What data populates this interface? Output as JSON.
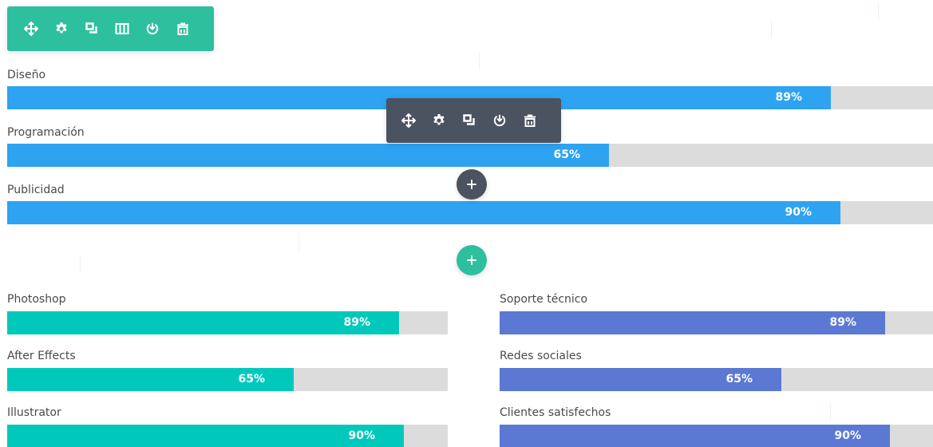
{
  "colors": {
    "row_toolbar_bg": "#2ebf9e",
    "module_toolbar_bg": "#4b5260",
    "blue_bar": "#2ea3f2",
    "teal_bar": "#00c9bb",
    "indigo_bar": "#5b78d3",
    "track": "#dcdcdc",
    "plus_dark": "#4b5260",
    "plus_green": "#2ebf9e"
  },
  "row_toolbar": {
    "icons": [
      "move-icon",
      "gear-icon",
      "duplicate-icon",
      "columns-icon",
      "save-icon",
      "trash-icon"
    ]
  },
  "module_toolbar": {
    "icons": [
      "move-icon",
      "gear-icon",
      "duplicate-icon",
      "save-icon",
      "trash-icon"
    ]
  },
  "top_bars": [
    {
      "label": "Diseño",
      "percent": 89,
      "percent_label": "89%"
    },
    {
      "label": "Programación",
      "percent": 65,
      "percent_label": "65%"
    },
    {
      "label": "Publicidad",
      "percent": 90,
      "percent_label": "90%"
    }
  ],
  "left_bars": [
    {
      "label": "Photoshop",
      "percent": 89,
      "percent_label": "89%"
    },
    {
      "label": "After Effects",
      "percent": 65,
      "percent_label": "65%"
    },
    {
      "label": "Illustrator",
      "percent": 90,
      "percent_label": "90%"
    }
  ],
  "right_bars": [
    {
      "label": "Soporte técnico",
      "percent": 89,
      "percent_label": "89%"
    },
    {
      "label": "Redes sociales",
      "percent": 65,
      "percent_label": "65%"
    },
    {
      "label": "Clientes satisfechos",
      "percent": 90,
      "percent_label": "90%"
    }
  ]
}
